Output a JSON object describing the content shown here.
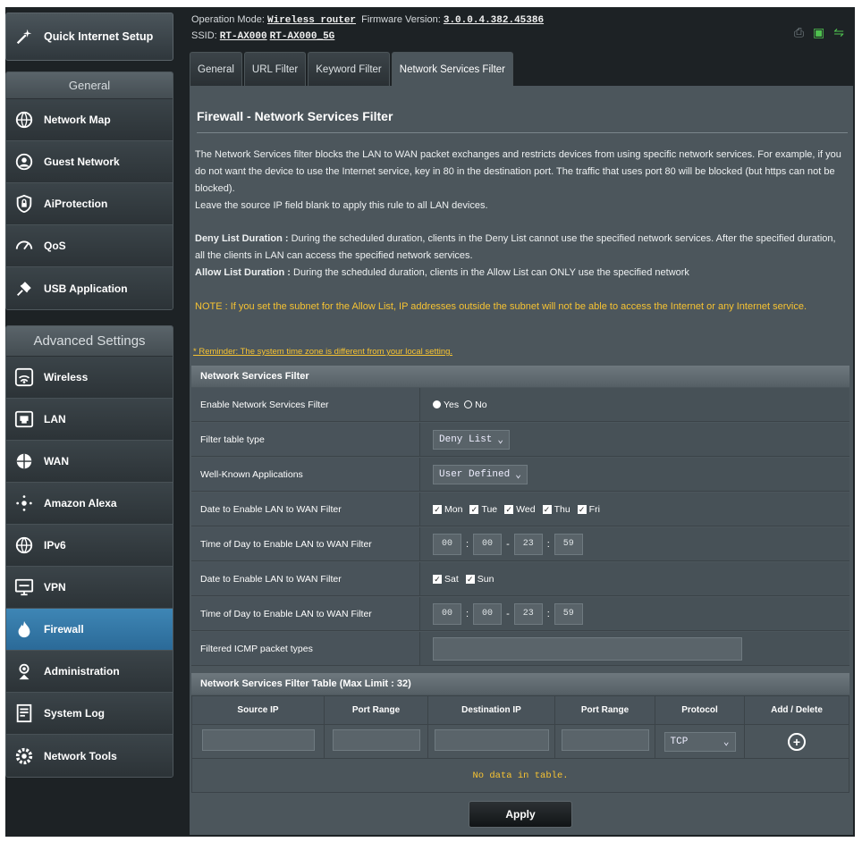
{
  "header": {
    "operation_mode_label": "Operation Mode:",
    "operation_mode": "Wireless router",
    "firmware_label": "Firmware Version:",
    "firmware": "3.0.0.4.382.45386",
    "ssid_label": "SSID:",
    "ssid_1": "RT-AX000",
    "ssid_2": "RT-AX000_5G"
  },
  "sidebar": {
    "quick_setup": "Quick Internet Setup",
    "general_title": "General",
    "general_items": [
      "Network Map",
      "Guest Network",
      "AiProtection",
      "QoS",
      "USB Application"
    ],
    "advanced_title": "Advanced Settings",
    "advanced_items": [
      "Wireless",
      "LAN",
      "WAN",
      "Amazon Alexa",
      "IPv6",
      "VPN",
      "Firewall",
      "Administration",
      "System Log",
      "Network Tools"
    ],
    "active_item": "Firewall"
  },
  "tabs": [
    "General",
    "URL Filter",
    "Keyword Filter",
    "Network Services Filter"
  ],
  "active_tab": "Network Services Filter",
  "page": {
    "title": "Firewall - Network Services Filter",
    "desc_1": "The Network Services filter blocks the LAN to WAN packet exchanges and restricts devices from using specific network services. For example, if you do not want the device to use the Internet service, key in 80 in the destination port. The traffic that uses port 80 will be blocked (but https can not be blocked).",
    "desc_2": "Leave the source IP field blank to apply this rule to all LAN devices.",
    "deny_label": "Deny List Duration :",
    "deny_text": "During the scheduled duration, clients in the Deny List cannot use the specified network services. After the specified duration, all the clients in LAN can access the specified network services.",
    "allow_label": "Allow List Duration :",
    "allow_text": "During the scheduled duration, clients in the Allow List can ONLY use the specified network",
    "note": "NOTE : If you set the subnet for the Allow List, IP addresses outside the subnet will not be able to access the Internet or any Internet service.",
    "reminder": "* Reminder: The system time zone is different from your local setting."
  },
  "filter_section": {
    "title": "Network Services Filter",
    "enable_label": "Enable Network Services Filter",
    "yes": "Yes",
    "no": "No",
    "type_label": "Filter table type",
    "type_value": "Deny List",
    "apps_label": "Well-Known Applications",
    "apps_value": "User Defined",
    "date1_label": "Date to Enable LAN to WAN Filter",
    "weekdays": [
      "Mon",
      "Tue",
      "Wed",
      "Thu",
      "Fri"
    ],
    "time1_label": "Time of Day to Enable LAN to WAN Filter",
    "time1": [
      "00",
      "00",
      "23",
      "59"
    ],
    "date2_label": "Date to Enable LAN to WAN Filter",
    "weekend": [
      "Sat",
      "Sun"
    ],
    "time2_label": "Time of Day to Enable LAN to WAN Filter",
    "time2": [
      "00",
      "00",
      "23",
      "59"
    ],
    "icmp_label": "Filtered ICMP packet types"
  },
  "filter_table": {
    "title": "Network Services Filter Table (Max Limit : 32)",
    "columns": [
      "Source IP",
      "Port Range",
      "Destination IP",
      "Port Range",
      "Protocol",
      "Add / Delete"
    ],
    "protocol_value": "TCP",
    "empty": "No data in table."
  },
  "apply_label": "Apply"
}
